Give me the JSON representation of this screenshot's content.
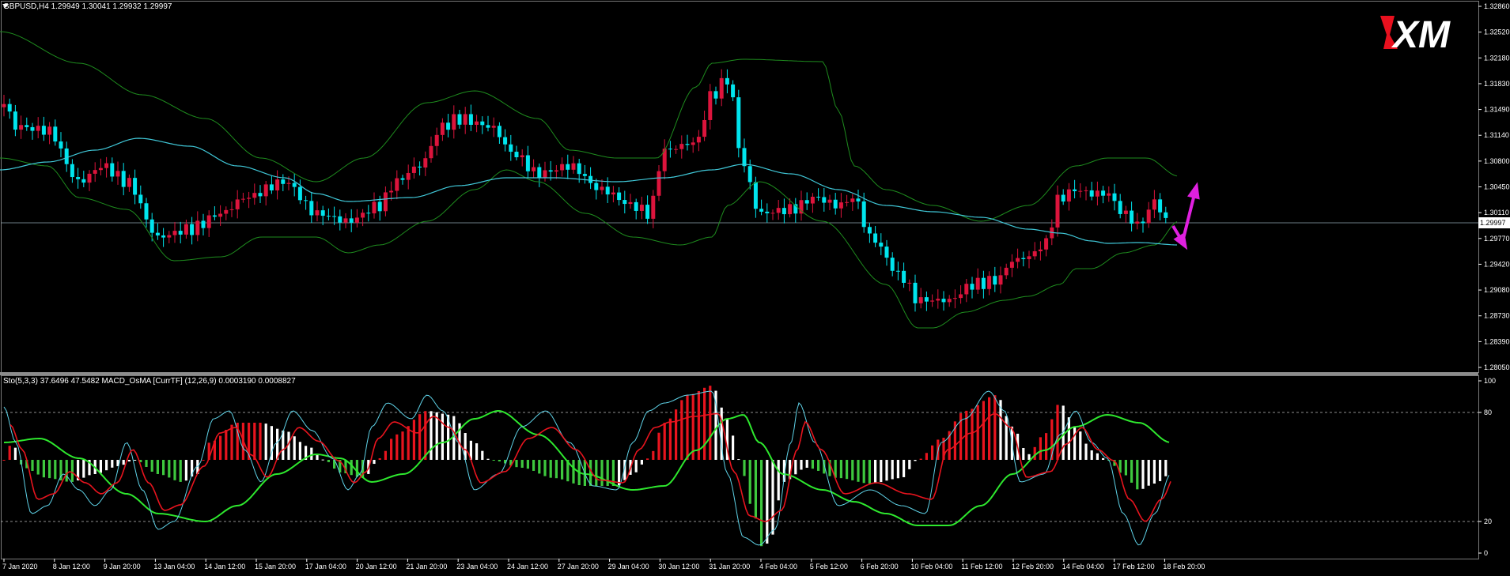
{
  "main": {
    "symbol_info": "GBPUSD,H4  1.29949 1.30041 1.29932 1.29997",
    "current_price_label": "1.29997",
    "y_axis_labels": [
      "1.32860",
      "1.32520",
      "1.32180",
      "1.31830",
      "1.31490",
      "1.31140",
      "1.30800",
      "1.30450",
      "1.30110",
      "1.29770",
      "1.29420",
      "1.29080",
      "1.28730",
      "1.28390",
      "1.28050"
    ]
  },
  "sub": {
    "indicator_info": "Sto(5,3,3) 37.6496 47.5482  MACD_OsMA [CurrTF] (12,26,9) 0.0003190 0.0008827",
    "y_axis_labels": [
      "100",
      "80",
      "20",
      "0"
    ]
  },
  "x_axis_labels": [
    "7 Jan 2020",
    "8 Jan 12:00",
    "9 Jan 20:00",
    "13 Jan 04:00",
    "14 Jan 12:00",
    "15 Jan 20:00",
    "17 Jan 04:00",
    "20 Jan 12:00",
    "21 Jan 20:00",
    "23 Jan 04:00",
    "24 Jan 12:00",
    "27 Jan 20:00",
    "29 Jan 04:00",
    "30 Jan 12:00",
    "31 Jan 20:00",
    "4 Feb 04:00",
    "5 Feb 12:00",
    "6 Feb 20:00",
    "10 Feb 04:00",
    "11 Feb 12:00",
    "12 Feb 20:00",
    "14 Feb 04:00",
    "17 Feb 12:00",
    "18 Feb 20:00"
  ],
  "logo_text": "XM",
  "colors": {
    "bull": "#DC143C",
    "bear": "#00E5EE",
    "bollinger": "#1E8C1E",
    "ma": "#40C8D8",
    "sto_main": "#5FD3E8",
    "sto_signal": "#E8141E",
    "macd_signal": "#2EE82E",
    "hist_pos": "#E8141E",
    "hist_neg": "#3EC83E",
    "hist_fade": "#FFFFFF",
    "arrow": "#E020E0",
    "grid": "#7A7A7A"
  }
}
